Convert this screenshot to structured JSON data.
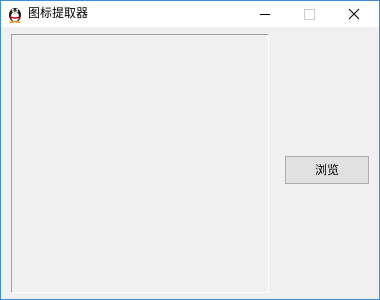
{
  "window": {
    "title": "图标提取器",
    "app_icon": "penguin-icon",
    "controls": {
      "minimize_icon": "minimize-icon",
      "maximize_icon": "maximize-icon",
      "close_icon": "close-icon"
    },
    "accent_color": "#3c8fd6"
  },
  "main": {
    "browse_label": "浏览"
  }
}
